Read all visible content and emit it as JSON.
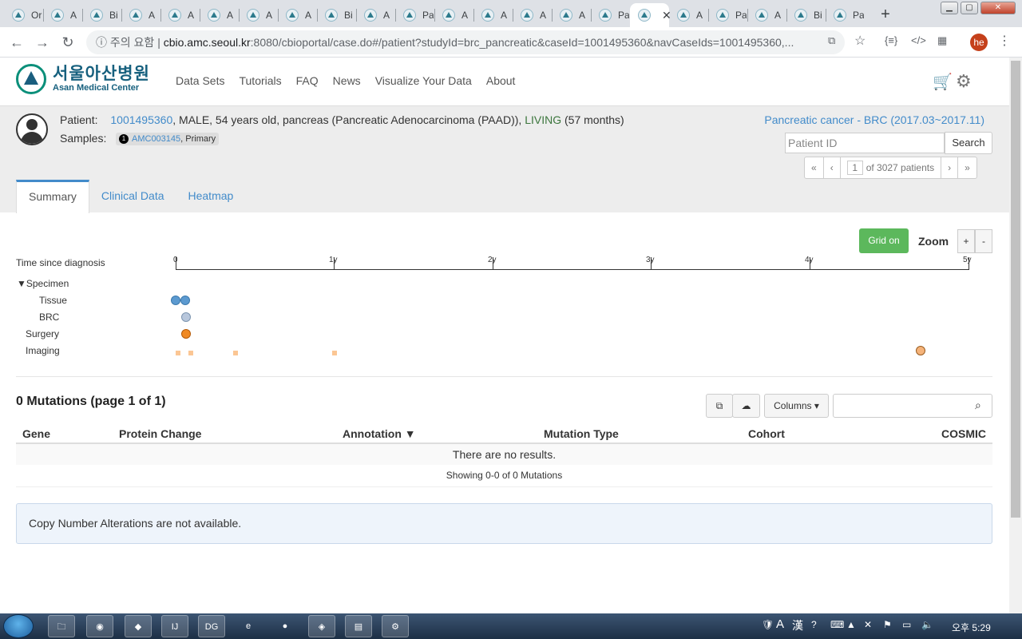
{
  "browser": {
    "tabs": [
      "Or",
      "A",
      "Bi",
      "A",
      "A",
      "A",
      "A",
      "A",
      "Bi",
      "A",
      "Pa",
      "A",
      "A",
      "A",
      "A",
      "Pa",
      "",
      "A",
      "Pa",
      "A",
      "Bi",
      "Pa"
    ],
    "active_tab_index": 16,
    "address": {
      "security": "주의 요함",
      "host": "cbio.amc.seoul.kr",
      "path": ":8080/cbioportal/case.do#/patient?studyId=brc_pancreatic&caseId=1001495360&navCaseIds=1001495360,..."
    },
    "profile_initials": "he"
  },
  "header": {
    "logo_korean": "서울아산병원",
    "logo_english": "Asan Medical Center",
    "nav": [
      "Data Sets",
      "Tutorials",
      "FAQ",
      "News",
      "Visualize Your Data",
      "About"
    ]
  },
  "patient": {
    "label": "Patient:",
    "id": "1001495360",
    "details": ", MALE, 54 years old, pancreas (Pancreatic Adenocarcinoma (PAAD)), ",
    "status": "LIVING",
    "months": " (57 months)",
    "samples_label": "Samples:",
    "sample_number": "1",
    "sample_id": "AMC003145",
    "sample_type": ", Primary",
    "study": "Pancreatic cancer - BRC (2017.03~2017.11)",
    "search_placeholder": "Patient ID",
    "search_button": "Search",
    "pager": {
      "first": "«",
      "prev": "‹",
      "page": "1",
      "of": "of 3027 patients",
      "next": "›",
      "last": "»"
    }
  },
  "tabs": [
    "Summary",
    "Clinical Data",
    "Heatmap"
  ],
  "timeline": {
    "grid_button": "Grid on",
    "zoom_label": "Zoom",
    "zoom_in": "+",
    "zoom_out": "-",
    "axis_label": "Time since diagnosis",
    "ticks": [
      "0",
      "1y",
      "2y",
      "3y",
      "4y",
      "5y"
    ],
    "tracks": {
      "specimen": "▼Specimen",
      "tissue": "Tissue",
      "brc": "BRC",
      "surgery": "Surgery",
      "imaging": "Imaging"
    }
  },
  "mutations": {
    "title": "0 Mutations (page 1 of 1)",
    "columns_button": "Columns ▾",
    "columns": [
      "Gene",
      "Protein Change",
      "Annotation ▼",
      "Mutation Type",
      "Cohort",
      "COSMIC"
    ],
    "empty": "There are no results.",
    "showing": "Showing 0-0 of 0 Mutations"
  },
  "cna_message": "Copy Number Alterations are not available.",
  "taskbar": {
    "clock": "오후 5:29"
  },
  "colors": {
    "link": "#428bca",
    "living": "#3c763d",
    "grid_button": "#5cb85c",
    "tissue": "#5c9ad0",
    "surgery": "#f08a24",
    "imaging": "#fbc694"
  }
}
